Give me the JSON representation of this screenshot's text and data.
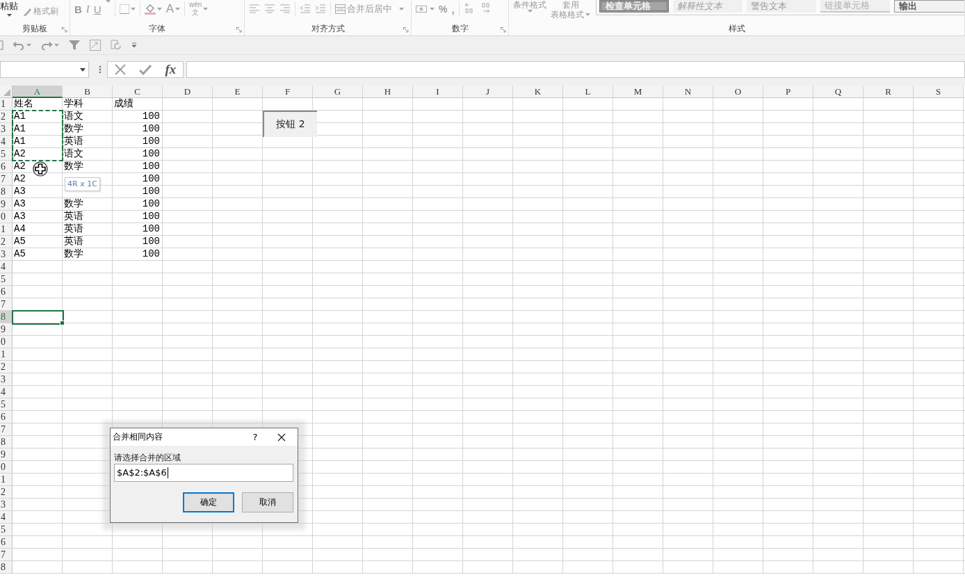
{
  "ribbon": {
    "clipboard": {
      "label": "剪贴板",
      "paste": "粘贴",
      "format_painter": "格式刷"
    },
    "font": {
      "label": "字体",
      "bold": "B",
      "italic": "I",
      "underline": "U",
      "font_color": "A",
      "phonetic_top": "wén",
      "phonetic_bottom": "文"
    },
    "alignment": {
      "label": "对齐方式",
      "merge": "合并后居中"
    },
    "number": {
      "label": "数字",
      "percent": "%",
      "comma": ","
    },
    "styles": {
      "label": "样式",
      "conditional": "条件格式",
      "table_format_top": "套用",
      "table_format_bottom": "表格格式",
      "cell_styles": [
        {
          "label": "检查单元格",
          "kind": "check"
        },
        {
          "label": "解释性文本",
          "kind": "explanatory"
        },
        {
          "label": "警告文本",
          "kind": "warning"
        },
        {
          "label": "链接单元格",
          "kind": "linked"
        },
        {
          "label": "输出",
          "kind": "output"
        }
      ]
    }
  },
  "formula_bar": {
    "function_button": "fx"
  },
  "columns": [
    {
      "label": "A",
      "selected": true
    },
    {
      "label": "B",
      "selected": false
    },
    {
      "label": "C",
      "selected": false
    },
    {
      "label": "D",
      "selected": false
    },
    {
      "label": "E",
      "selected": false
    },
    {
      "label": "F",
      "selected": false
    },
    {
      "label": "G",
      "selected": false
    },
    {
      "label": "H",
      "selected": false
    },
    {
      "label": "I",
      "selected": false
    },
    {
      "label": "J",
      "selected": false
    },
    {
      "label": "K",
      "selected": false
    },
    {
      "label": "L",
      "selected": false
    },
    {
      "label": "M",
      "selected": false
    },
    {
      "label": "N",
      "selected": false
    },
    {
      "label": "O",
      "selected": false
    },
    {
      "label": "P",
      "selected": false
    },
    {
      "label": "Q",
      "selected": false
    },
    {
      "label": "R",
      "selected": false
    },
    {
      "label": "S",
      "selected": false
    }
  ],
  "rows": [
    {
      "header": "1",
      "selected": false,
      "copying": false,
      "cells": {
        "a": {
          "text": "姓名"
        },
        "b": {
          "text": "学科"
        },
        "c": {
          "text": "成绩",
          "numeric": false
        }
      }
    },
    {
      "header": "2",
      "selected": false,
      "copying": true,
      "cells": {
        "a": {
          "text": "A1"
        },
        "b": {
          "text": "语文"
        },
        "c": {
          "text": "100",
          "numeric": true
        }
      }
    },
    {
      "header": "3",
      "selected": false,
      "copying": true,
      "cells": {
        "a": {
          "text": "A1"
        },
        "b": {
          "text": "数学"
        },
        "c": {
          "text": "100",
          "numeric": true
        }
      }
    },
    {
      "header": "4",
      "selected": false,
      "copying": true,
      "cells": {
        "a": {
          "text": "A1"
        },
        "b": {
          "text": "英语"
        },
        "c": {
          "text": "100",
          "numeric": true
        }
      }
    },
    {
      "header": "5",
      "selected": false,
      "copying": true,
      "cells": {
        "a": {
          "text": "A2"
        },
        "b": {
          "text": "语文"
        },
        "c": {
          "text": "100",
          "numeric": true
        }
      }
    },
    {
      "header": "6",
      "selected": false,
      "copying": false,
      "cells": {
        "a": {
          "text": "A2"
        },
        "b": {
          "text": "数学"
        },
        "c": {
          "text": "100",
          "numeric": true
        }
      }
    },
    {
      "header": "7",
      "selected": false,
      "copying": false,
      "cells": {
        "a": {
          "text": "A2"
        },
        "c": {
          "text": "100",
          "numeric": true
        }
      }
    },
    {
      "header": "8",
      "selected": false,
      "copying": false,
      "cells": {
        "a": {
          "text": "A3"
        },
        "c": {
          "text": "100",
          "numeric": true
        }
      }
    },
    {
      "header": "9",
      "selected": false,
      "copying": false,
      "cells": {
        "a": {
          "text": "A3"
        },
        "b": {
          "text": "数学"
        },
        "c": {
          "text": "100",
          "numeric": true
        }
      }
    },
    {
      "header": "0",
      "selected": false,
      "copying": false,
      "cells": {
        "a": {
          "text": "A3"
        },
        "b": {
          "text": "英语"
        },
        "c": {
          "text": "100",
          "numeric": true
        }
      }
    },
    {
      "header": "1",
      "selected": false,
      "copying": false,
      "cells": {
        "a": {
          "text": "A4"
        },
        "b": {
          "text": "英语"
        },
        "c": {
          "text": "100",
          "numeric": true
        }
      }
    },
    {
      "header": "2",
      "selected": false,
      "copying": false,
      "cells": {
        "a": {
          "text": "A5"
        },
        "b": {
          "text": "英语"
        },
        "c": {
          "text": "100",
          "numeric": true
        }
      }
    },
    {
      "header": "3",
      "selected": false,
      "copying": false,
      "cells": {
        "a": {
          "text": "A5"
        },
        "b": {
          "text": "数学"
        },
        "c": {
          "text": "100",
          "numeric": true
        }
      }
    },
    {
      "header": "4",
      "selected": false,
      "copying": false
    },
    {
      "header": "5",
      "selected": false,
      "copying": false
    },
    {
      "header": "6",
      "selected": false,
      "copying": false
    },
    {
      "header": "7",
      "selected": false,
      "copying": false
    },
    {
      "header": "8",
      "selected": true,
      "copying": false
    },
    {
      "header": "9",
      "selected": false,
      "copying": false
    },
    {
      "header": "0",
      "selected": false,
      "copying": false
    },
    {
      "header": "1",
      "selected": false,
      "copying": false
    },
    {
      "header": "2",
      "selected": false,
      "copying": false
    },
    {
      "header": "3",
      "selected": false,
      "copying": false
    },
    {
      "header": "4",
      "selected": false,
      "copying": false
    },
    {
      "header": "5",
      "selected": false,
      "copying": false
    },
    {
      "header": "6",
      "selected": false,
      "copying": false
    },
    {
      "header": "7",
      "selected": false,
      "copying": false
    },
    {
      "header": "8",
      "selected": false,
      "copying": false
    },
    {
      "header": "9",
      "selected": false,
      "copying": false
    },
    {
      "header": "0",
      "selected": false,
      "copying": false
    },
    {
      "header": "1",
      "selected": false,
      "copying": false
    },
    {
      "header": "2",
      "selected": false,
      "copying": false
    },
    {
      "header": "3",
      "selected": false,
      "copying": false
    },
    {
      "header": "4",
      "selected": false,
      "copying": false
    },
    {
      "header": "5",
      "selected": false,
      "copying": false
    },
    {
      "header": "6",
      "selected": false,
      "copying": false
    },
    {
      "header": "7",
      "selected": false,
      "copying": false
    },
    {
      "header": "8",
      "selected": false,
      "copying": false
    }
  ],
  "sheet_button": "按钮 2",
  "tooltip": "4R x 1C",
  "dialog": {
    "title": "合并相同内容",
    "help": "?",
    "label": "请选择合并的区域",
    "value": "$A$2:$A$6",
    "ok": "确定",
    "cancel": "取消"
  }
}
